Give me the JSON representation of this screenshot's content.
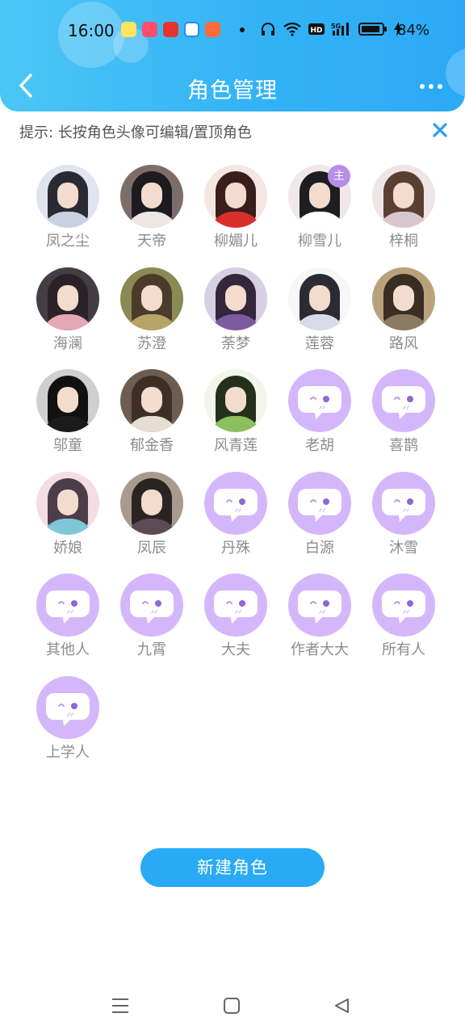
{
  "status_bar": {
    "time": "16:00",
    "battery": "84%"
  },
  "header": {
    "title": "角色管理"
  },
  "tip": {
    "text": "提示: 长按角色头像可编辑/置顶角色"
  },
  "characters": [
    {
      "name": "凤之尘",
      "type": "photo",
      "hair": "#2a2a33",
      "body": "#c9d1e0",
      "bg": "#dfe4ee"
    },
    {
      "name": "天帝",
      "type": "photo",
      "hair": "#1c1b20",
      "body": "#ede7e4",
      "bg": "#7d6d66"
    },
    {
      "name": "柳媚儿",
      "type": "photo",
      "hair": "#3a1d1d",
      "body": "#d7302b",
      "bg": "#f4e7e2"
    },
    {
      "name": "柳雪儿",
      "type": "photo",
      "hair": "#1d1d22",
      "body": "#ffffff",
      "bg": "#efe7ea",
      "badge": "主"
    },
    {
      "name": "梓桐",
      "type": "photo",
      "hair": "#5b4032",
      "body": "#d8c6cf",
      "bg": "#efe4e6"
    },
    {
      "name": "海澜",
      "type": "photo",
      "hair": "#2b2227",
      "body": "#e6a7b4",
      "bg": "#453d44"
    },
    {
      "name": "苏澄",
      "type": "photo",
      "hair": "#4a3b2a",
      "body": "#b6a468",
      "bg": "#8b8a55"
    },
    {
      "name": "荼梦",
      "type": "photo",
      "hair": "#33263d",
      "body": "#7d59a0",
      "bg": "#d8cfe3"
    },
    {
      "name": "莲蓉",
      "type": "photo",
      "hair": "#2c2b33",
      "body": "#d9dbe8",
      "bg": "#f7f6f8"
    },
    {
      "name": "路风",
      "type": "photo",
      "hair": "#3a2d24",
      "body": "#8b7a64",
      "bg": "#b9a27b"
    },
    {
      "name": "邬童",
      "type": "photo",
      "hair": "#111111",
      "body": "#1b1b1b",
      "bg": "#cfcfcf"
    },
    {
      "name": "郁金香",
      "type": "photo",
      "hair": "#3e2f24",
      "body": "#e6ded3",
      "bg": "#6d5d51"
    },
    {
      "name": "风青莲",
      "type": "photo",
      "hair": "#24301c",
      "body": "#8cbf5d",
      "bg": "#f2f6e8"
    },
    {
      "name": "老胡",
      "type": "default"
    },
    {
      "name": "喜鹊",
      "type": "default"
    },
    {
      "name": "娇娘",
      "type": "photo",
      "hair": "#4d3c4a",
      "body": "#7ec7d6",
      "bg": "#f3dde3"
    },
    {
      "name": "凤辰",
      "type": "photo",
      "hair": "#2b2424",
      "body": "#5c4b52",
      "bg": "#a89a8c"
    },
    {
      "name": "丹殊",
      "type": "default"
    },
    {
      "name": "白源",
      "type": "default"
    },
    {
      "name": "沐雪",
      "type": "default"
    },
    {
      "name": "其他人",
      "type": "default"
    },
    {
      "name": "九霄",
      "type": "default"
    },
    {
      "name": "大夫",
      "type": "default"
    },
    {
      "name": "作者大大",
      "type": "default"
    },
    {
      "name": "所有人",
      "type": "default"
    },
    {
      "name": "上学人",
      "type": "default"
    }
  ],
  "new_button": {
    "label": "新建角色"
  },
  "colors": {
    "accent": "#29aaf4",
    "default_avatar": "#d4b7fa",
    "badge": "#b68ee8"
  },
  "icons": {
    "back": "chevron-left-icon",
    "more": "more-dots-icon",
    "close": "close-icon",
    "nav_menu": "menu-icon",
    "nav_home": "square-home-icon",
    "nav_back": "triangle-back-icon"
  }
}
